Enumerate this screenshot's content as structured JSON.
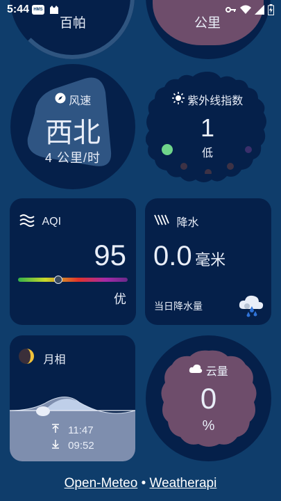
{
  "status_bar": {
    "time": "5:44",
    "hms": "HMS"
  },
  "top_cards": {
    "pressure_unit": "百帕",
    "visibility_unit": "公里"
  },
  "wind": {
    "label": "风速",
    "direction": "西北",
    "speed": "4 公里/时"
  },
  "uv": {
    "label": "紫外线指数",
    "value": "1",
    "level": "低"
  },
  "aqi": {
    "label": "AQI",
    "value": "95",
    "level": "优",
    "level_position": 0.37
  },
  "precip": {
    "label": "降水",
    "value": "0.0",
    "unit": "毫米",
    "caption": "当日降水量"
  },
  "moon": {
    "label": "月相",
    "rise": "11:47",
    "set": "09:52"
  },
  "cloud": {
    "label": "云量",
    "value": "0",
    "unit": "%"
  },
  "footer": {
    "source1": "Open-Meteo",
    "sep": "•",
    "source2": "Weatherapi"
  },
  "colors": {
    "background": "#0f3d6b",
    "card": "#05204a",
    "accent_blob": "#6e4d6b",
    "wind_shape": "#2f5583"
  }
}
